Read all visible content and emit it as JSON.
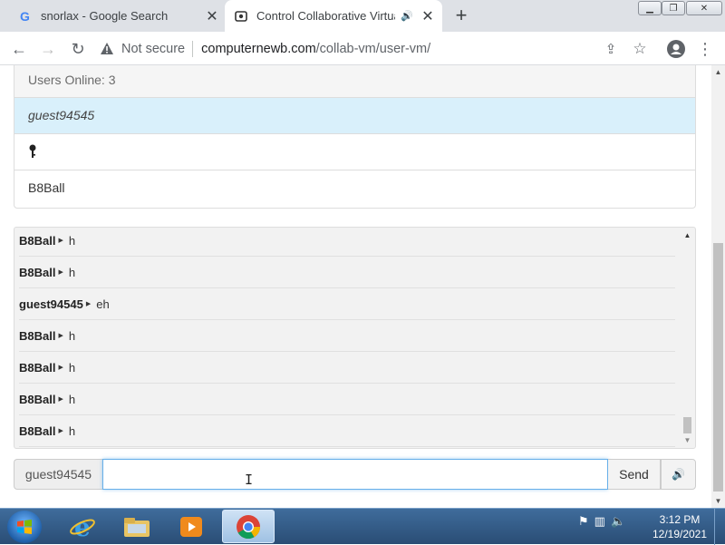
{
  "tabs": [
    {
      "title": "snorlax - Google Search",
      "icon": "google-g-icon"
    },
    {
      "title": "Control Collaborative Virtual",
      "icon": "collabvm-icon"
    }
  ],
  "toolbar": {
    "security_label": "Not secure",
    "url_host": "computernewb.com",
    "url_path": "/collab-vm/user-vm/"
  },
  "users_panel": {
    "header": "Users Online: 3",
    "users": [
      "guest94545",
      "🔑",
      "B8Ball"
    ]
  },
  "chat": {
    "messages": [
      {
        "user": "B8Ball",
        "text": "h"
      },
      {
        "user": "B8Ball",
        "text": "h"
      },
      {
        "user": "guest94545",
        "text": "eh"
      },
      {
        "user": "B8Ball",
        "text": "h"
      },
      {
        "user": "B8Ball",
        "text": "h"
      },
      {
        "user": "B8Ball",
        "text": "h"
      },
      {
        "user": "B8Ball",
        "text": "h"
      }
    ],
    "username": "guest94545",
    "input_value": "",
    "send_label": "Send"
  },
  "taskbar": {
    "time": "3:12 PM",
    "date": "12/19/2021"
  },
  "colors": {
    "selected_user_bg": "#d9f0fb",
    "input_focus": "#66afe9",
    "taskbar": "#2a4d75"
  }
}
